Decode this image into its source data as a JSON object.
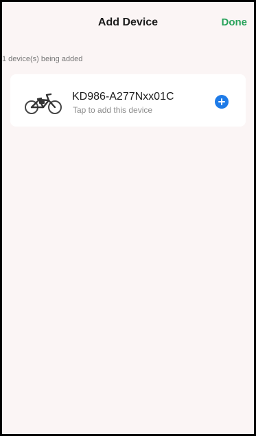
{
  "header": {
    "title": "Add Device",
    "done_label": "Done"
  },
  "section": {
    "label": "1 device(s) being added"
  },
  "devices": [
    {
      "name": "KD986-A277Nxx01C",
      "subtitle": "Tap to add this device",
      "icon": "bicycle-icon",
      "action_icon": "add-plus-icon",
      "action_color": "#1e7be8"
    }
  ],
  "colors": {
    "done_accent": "#27a25a",
    "background": "#fbf5f5"
  }
}
